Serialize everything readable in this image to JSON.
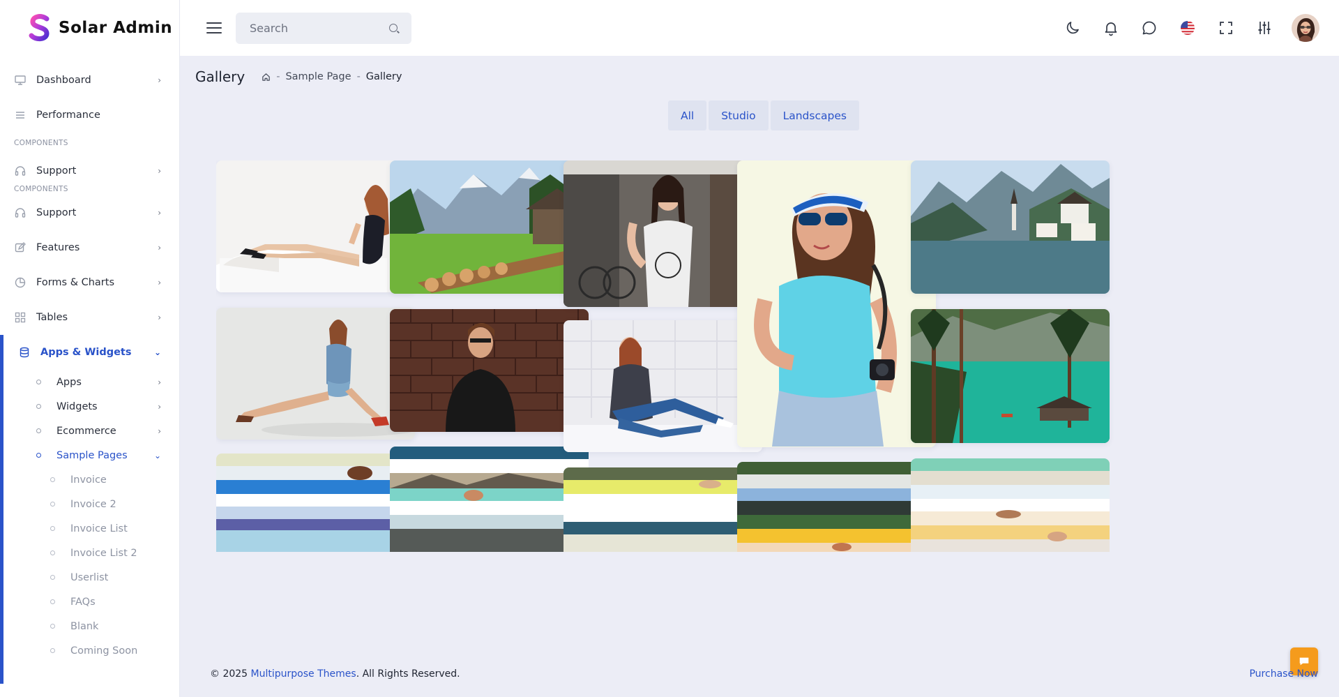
{
  "brand": {
    "name": "Solar Admin"
  },
  "header": {
    "search_placeholder": "Search",
    "icons": [
      "menu-icon",
      "moon-icon",
      "bell-icon",
      "chat-icon",
      "us-flag-icon",
      "fullscreen-icon",
      "settings-sliders-icon",
      "user-avatar"
    ]
  },
  "sidebar": {
    "items": [
      {
        "label": "Dashboard",
        "icon": "monitor-icon",
        "has_arrow": true
      },
      {
        "label": "Performance",
        "icon": "lines-icon",
        "has_arrow": false
      }
    ],
    "section1": "COMPONENTS",
    "support1": "Support",
    "section2": "COMPONENTS",
    "more": [
      {
        "label": "Support",
        "icon": "headset-icon"
      },
      {
        "label": "Features",
        "icon": "edit-icon"
      },
      {
        "label": "Forms & Charts",
        "icon": "pie-icon"
      },
      {
        "label": "Tables",
        "icon": "grid-icon"
      }
    ],
    "active": {
      "label": "Apps & Widgets",
      "icon": "database-icon"
    },
    "sub": [
      {
        "label": "Apps"
      },
      {
        "label": "Widgets"
      },
      {
        "label": "Ecommerce"
      }
    ],
    "sample_pages": "Sample Pages",
    "subsub": [
      "Invoice",
      "Invoice 2",
      "Invoice List",
      "Invoice List 2",
      "Userlist",
      "FAQs",
      "Blank",
      "Coming Soon"
    ]
  },
  "page": {
    "title": "Gallery",
    "breadcrumb": [
      "Sample Page",
      "Gallery"
    ],
    "breadcrumb_sep": "-"
  },
  "filters": [
    "All",
    "Studio",
    "Landscapes"
  ],
  "gallery": {
    "images": [
      "woman-in-black-dress-on-white-couch",
      "mountain-meadow-with-logs-and-cabin",
      "woman-in-tank-top-street",
      "woman-with-blue-visor-and-camera",
      "alpine-lake-village",
      "woman-in-denim-sitting",
      "man-in-black-tshirt-brick-wall",
      "woman-in-sweater-on-white-bed",
      "turquoise-lake-with-pines"
    ]
  },
  "colors": {
    "accent": "#2a53c9",
    "background": "#ecedf6",
    "fab": "#f59b1c"
  },
  "footer": {
    "prefix": "© 2025",
    "brand": "Multipurpose Themes",
    "suffix": ". All Rights Reserved.",
    "purchase": "Purchase Now"
  }
}
